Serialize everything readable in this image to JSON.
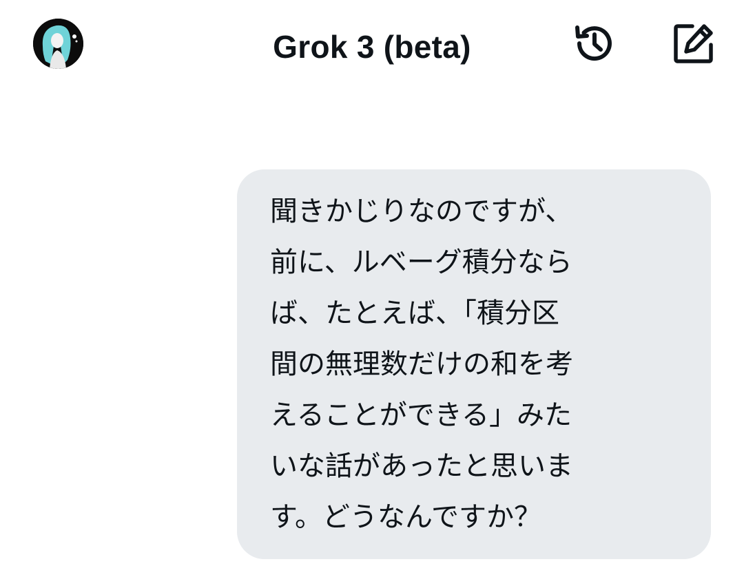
{
  "header": {
    "title": "Grok 3 (beta)",
    "avatar_icon": "user-avatar",
    "history_icon": "history-icon",
    "compose_icon": "compose-icon"
  },
  "conversation": {
    "messages": [
      {
        "role": "user",
        "text": "聞きかじりなのですが、\n前に、ルベーグ積分なら\nば、たとえば、「積分区\n間の無理数だけの和を考\nえることができる」みた\nいな話があったと思いま\nす。どうなんですか？"
      }
    ]
  },
  "colors": {
    "background": "#ffffff",
    "bubble": "#e8ebee",
    "text": "#0f1419"
  }
}
